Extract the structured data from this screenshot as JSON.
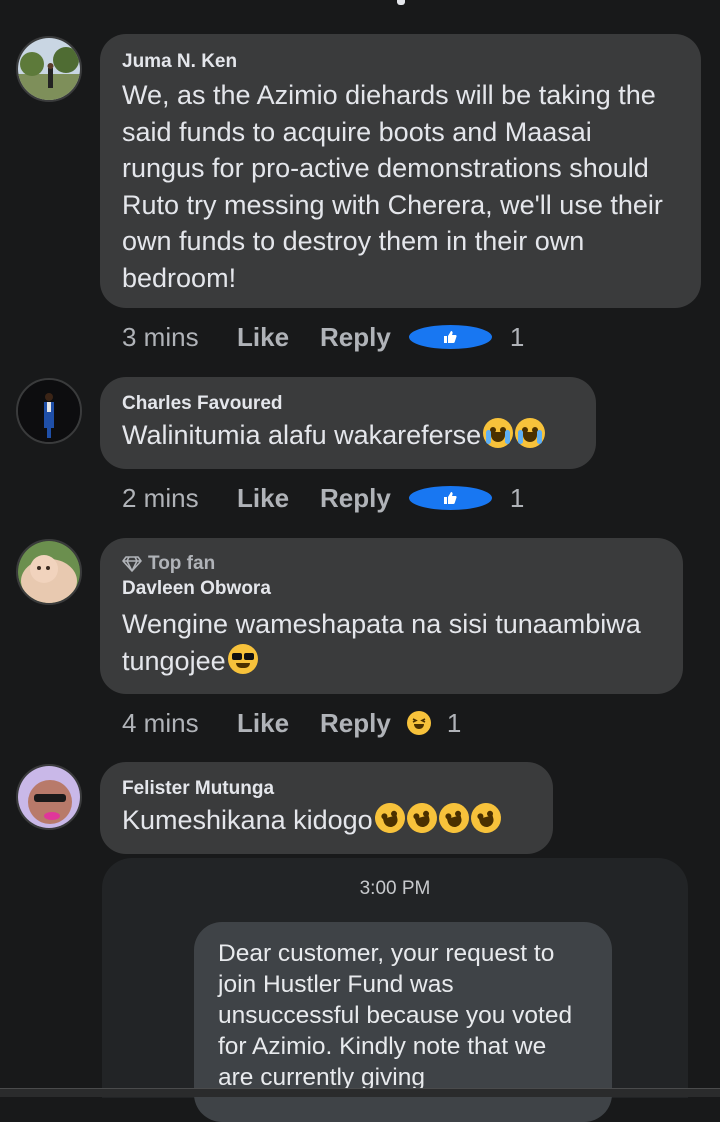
{
  "comments": [
    {
      "author": "Juma N. Ken",
      "text": "We, as the Azimio diehards will be taking the said funds to acquire boots and Maasai rungus for pro-active demonstrations should Ruto try messing with Cherera, we'll use their own funds to destroy them in their own bedroom!",
      "time": "3 mins",
      "like_label": "Like",
      "reply_label": "Reply",
      "reaction_count": "1",
      "reaction_icon": "like-icon"
    },
    {
      "author": "Charles Favoured",
      "text": "Walinitumia alafu wakareferse",
      "time": "2 mins",
      "like_label": "Like",
      "reply_label": "Reply",
      "reaction_count": "1",
      "reaction_icon": "like-icon"
    },
    {
      "badge": "Top fan",
      "author": "Davleen Obwora",
      "text": "Wengine wameshapata na sisi tunaambiwa tungojee",
      "time": "4 mins",
      "like_label": "Like",
      "reply_label": "Reply",
      "reaction_count": "1",
      "reaction_icon": "haha-icon"
    },
    {
      "author": "Felister Mutunga",
      "text": "Kumeshikana kidogo"
    }
  ],
  "attachment": {
    "time": "3:00 PM",
    "message": "Dear customer, your request to join Hustler Fund was unsuccessful because you voted for Azimio. Kindly note that we are currently giving"
  },
  "colors": {
    "background": "#18191a",
    "bubble": "#3a3b3c",
    "like_blue": "#1877f2",
    "meta_text": "#b0b3b8"
  }
}
